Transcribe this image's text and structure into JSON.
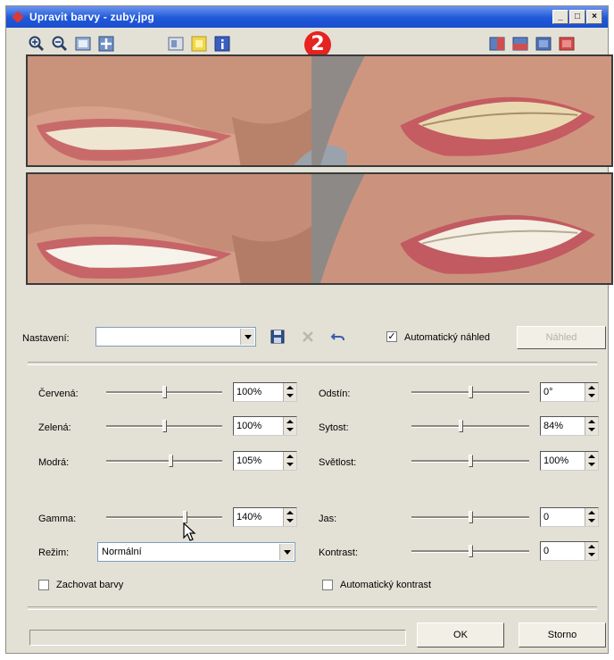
{
  "window": {
    "title": "Upravit barvy - zuby.jpg",
    "controls": [
      "_",
      "□",
      "×"
    ]
  },
  "toolbar": {
    "left_tools": [
      "zoom-in-icon",
      "zoom-out-icon",
      "fit-window-icon",
      "actual-size-icon"
    ],
    "middle_tools": [
      "compare-icon",
      "highlight-icon",
      "info-icon"
    ],
    "right_tools": [
      "split-vertical-icon",
      "split-horizontal-icon",
      "single-view-icon",
      "original-only-icon"
    ],
    "step_badge": "2"
  },
  "settings": {
    "label": "Nastavení:",
    "preset_value": "",
    "auto_preview_label": "Automatický náhled",
    "auto_preview_checked": true,
    "preview_button": "Náhled",
    "preview_button_enabled": false
  },
  "rgb": {
    "red": {
      "label": "Červená:",
      "value": "100%",
      "level": 0.5
    },
    "green": {
      "label": "Zelená:",
      "value": "100%",
      "level": 0.5
    },
    "blue": {
      "label": "Modrá:",
      "value": "105%",
      "level": 0.55
    }
  },
  "hsl": {
    "hue": {
      "label": "Odstín:",
      "value": "0°",
      "level": 0.5
    },
    "saturation": {
      "label": "Sytost:",
      "value": "84%",
      "level": 0.42
    },
    "lightness": {
      "label": "Světlost:",
      "value": "100%",
      "level": 0.5
    }
  },
  "gamma": {
    "label": "Gamma:",
    "value": "140%",
    "level": 0.68
  },
  "mode": {
    "label": "Režim:",
    "value": "Normální"
  },
  "brightness": {
    "label": "Jas:",
    "value": "0",
    "level": 0.5
  },
  "contrast": {
    "label": "Kontrast:",
    "value": "0",
    "level": 0.5
  },
  "preserve_colors": {
    "label": "Zachovat barvy",
    "checked": false
  },
  "auto_contrast": {
    "label": "Automatický kontrast",
    "checked": false
  },
  "buttons": {
    "ok": "OK",
    "cancel": "Storno"
  }
}
